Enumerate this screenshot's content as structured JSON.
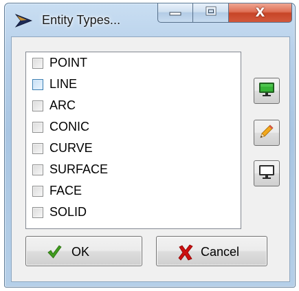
{
  "window": {
    "title": "Entity Types...",
    "caption_buttons": [
      {
        "icon": "minimize-icon"
      },
      {
        "icon": "maximize-icon"
      },
      {
        "icon": "close-icon",
        "label": "X"
      }
    ]
  },
  "entity_list": {
    "items": [
      {
        "label": "POINT",
        "checked": false
      },
      {
        "label": "LINE",
        "checked": false,
        "hovered": true
      },
      {
        "label": "ARC",
        "checked": false
      },
      {
        "label": "CONIC",
        "checked": false
      },
      {
        "label": "CURVE",
        "checked": false
      },
      {
        "label": "SURFACE",
        "checked": false
      },
      {
        "label": "FACE",
        "checked": false
      },
      {
        "label": "SOLID",
        "checked": false
      }
    ]
  },
  "side_buttons": [
    {
      "icon": "green-monitor-icon"
    },
    {
      "icon": "pencil-icon"
    },
    {
      "icon": "blank-monitor-icon"
    }
  ],
  "buttons": {
    "ok": {
      "label": "OK",
      "icon": "checkmark-icon"
    },
    "cancel": {
      "label": "Cancel",
      "icon": "red-x-icon"
    }
  },
  "colors": {
    "ok_check": "#3f9b1e",
    "cancel_x": "#cc1010",
    "monitor_green": "#2e9a2e",
    "close_button": "#c74527"
  }
}
